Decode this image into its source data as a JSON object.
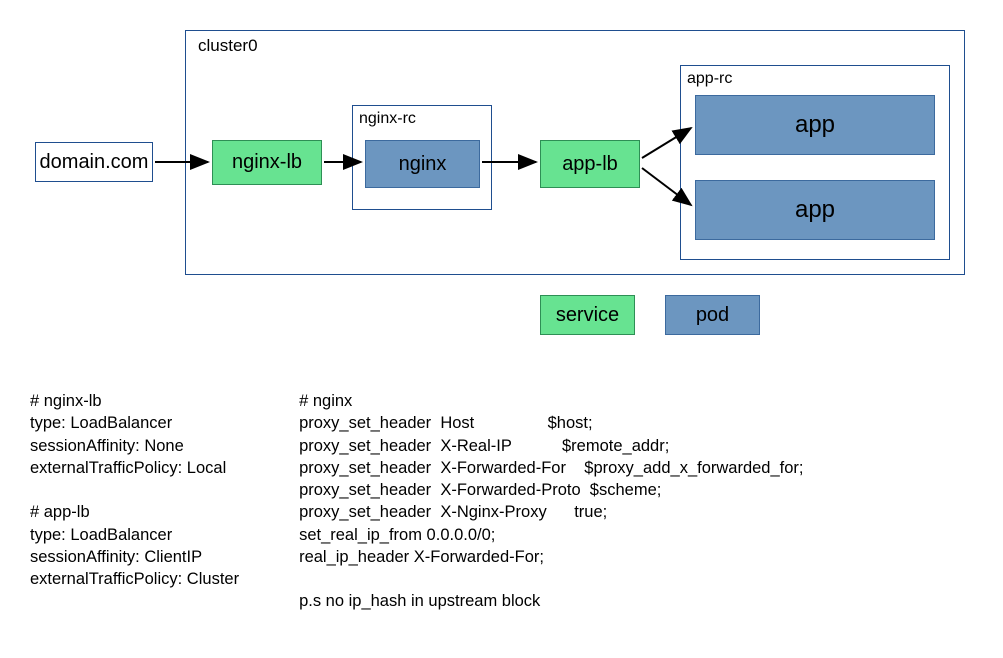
{
  "diagram": {
    "domain_label": "domain.com",
    "cluster_label": "cluster0",
    "nginx_lb": "nginx-lb",
    "nginx_rc_label": "nginx-rc",
    "nginx": "nginx",
    "app_lb": "app-lb",
    "app_rc_label": "app-rc",
    "app1": "app",
    "app2": "app"
  },
  "legend": {
    "service": "service",
    "pod": "pod"
  },
  "config": {
    "left": "# nginx-lb\ntype: LoadBalancer\nsessionAffinity: None\nexternalTrafficPolicy: Local\n\n# app-lb\ntype: LoadBalancer\nsessionAffinity: ClientIP\nexternalTrafficPolicy: Cluster",
    "right": "# nginx\nproxy_set_header  Host                $host;\nproxy_set_header  X-Real-IP           $remote_addr;\nproxy_set_header  X-Forwarded-For    $proxy_add_x_forwarded_for;\nproxy_set_header  X-Forwarded-Proto  $scheme;\nproxy_set_header  X-Nginx-Proxy      true;\nset_real_ip_from 0.0.0.0/0;\nreal_ip_header X-Forwarded-For;\n\np.s no ip_hash in upstream block"
  }
}
